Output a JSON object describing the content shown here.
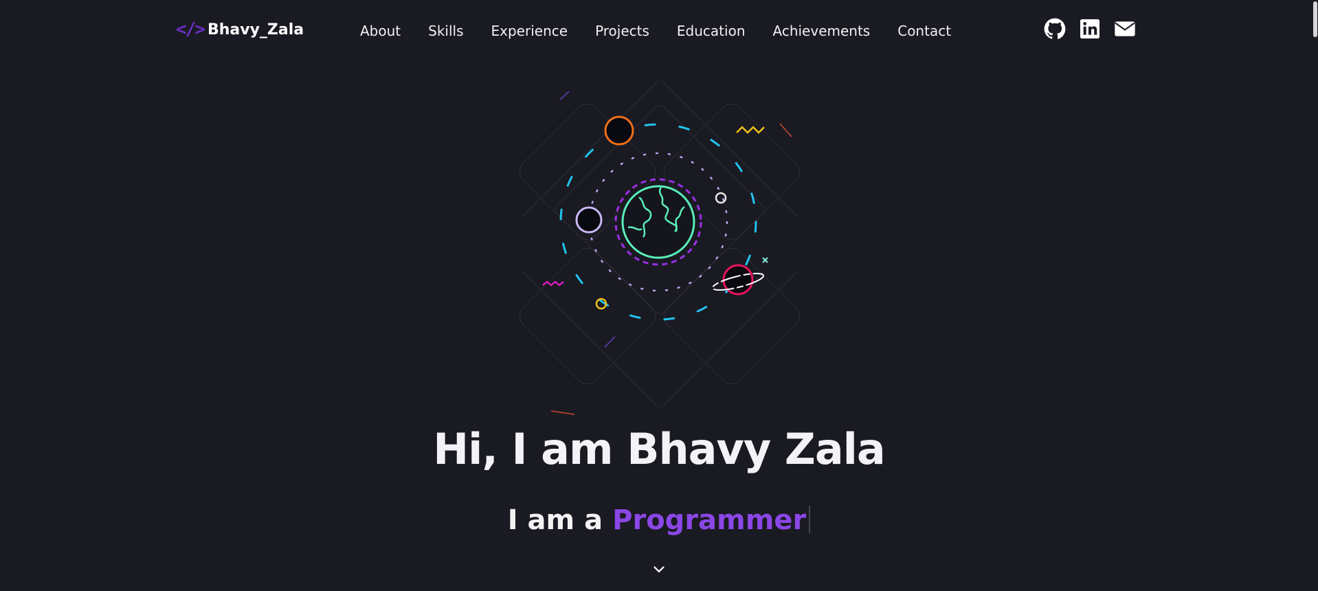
{
  "nav": {
    "logo_mark": "</>",
    "logo_text": "Bhavy_Zala",
    "links": [
      {
        "label": "About"
      },
      {
        "label": "Skills"
      },
      {
        "label": "Experience"
      },
      {
        "label": "Projects"
      },
      {
        "label": "Education"
      },
      {
        "label": "Achievements"
      },
      {
        "label": "Contact"
      }
    ],
    "socials": [
      {
        "icon": "github-icon"
      },
      {
        "icon": "linkedin-icon"
      },
      {
        "icon": "mail-icon"
      }
    ]
  },
  "hero": {
    "title": "Hi, I am Bhavy Zala",
    "subtitle_prefix": "I am a",
    "subtitle_role": "Programmer"
  },
  "colors": {
    "background": "#1a1a23",
    "accent": "#8b47e6",
    "logo": "#6a2fc2",
    "earth": "#5af0b9",
    "orbit_cyan": "#22c4ef",
    "orbit_lavender": "#b9a4f0"
  }
}
